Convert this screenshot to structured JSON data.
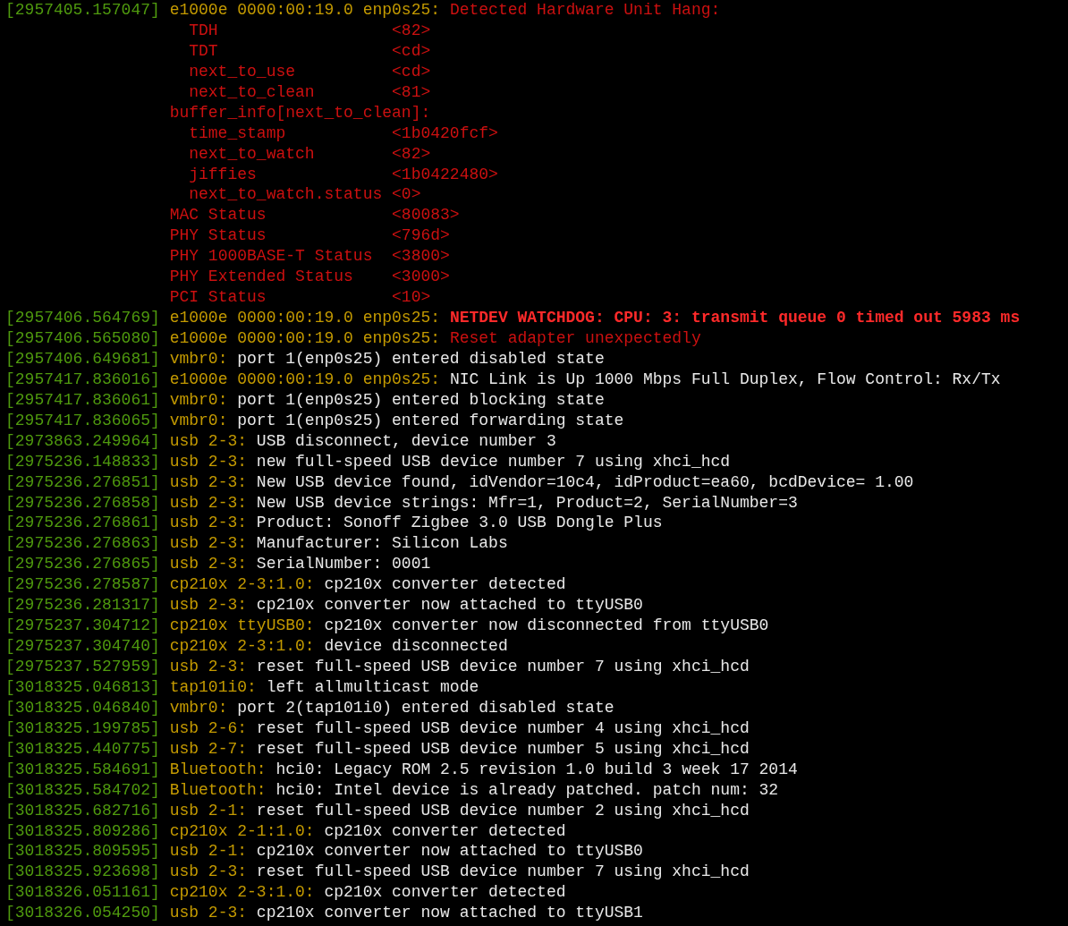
{
  "terminal": {
    "lines": [
      {
        "timestamp": "[2957405.157047]",
        "source": "e1000e 0000:00:19.0 enp0s25:",
        "message": "Detected Hardware Unit Hang:",
        "kind": "error",
        "details": [
          {
            "children": [
              {
                "label": "TDH",
                "value": "<82>"
              },
              {
                "label": "TDT",
                "value": "<cd>"
              },
              {
                "label": "next_to_use",
                "value": "<cd>"
              },
              {
                "label": "next_to_clean",
                "value": "<81>"
              }
            ]
          },
          {
            "label": "buffer_info[next_to_clean]:",
            "children": [
              {
                "label": "time_stamp",
                "value": "<1b0420fcf>"
              },
              {
                "label": "next_to_watch",
                "value": "<82>"
              },
              {
                "label": "jiffies",
                "value": "<1b0422480>"
              },
              {
                "label": "next_to_watch.status",
                "value": "<0>"
              }
            ]
          },
          {
            "label": "MAC Status",
            "value": "<80083>"
          },
          {
            "label": "PHY Status",
            "value": "<796d>"
          },
          {
            "label": "PHY 1000BASE-T Status",
            "value": "<3800>"
          },
          {
            "label": "PHY Extended Status",
            "value": "<3000>"
          },
          {
            "label": "PCI Status",
            "value": "<10>"
          }
        ]
      },
      {
        "timestamp": "[2957406.564769]",
        "source": "e1000e 0000:00:19.0 enp0s25:",
        "message": "NETDEV WATCHDOG: CPU: 3: transmit queue 0 timed out 5983 ms",
        "kind": "critical"
      },
      {
        "timestamp": "[2957406.565080]",
        "source": "e1000e 0000:00:19.0 enp0s25:",
        "message": "Reset adapter unexpectedly",
        "kind": "error"
      },
      {
        "timestamp": "[2957406.649681]",
        "source": "vmbr0:",
        "message": "port 1(enp0s25) entered disabled state",
        "kind": "normal"
      },
      {
        "timestamp": "[2957417.836016]",
        "source": "e1000e 0000:00:19.0 enp0s25:",
        "message": "NIC Link is Up 1000 Mbps Full Duplex, Flow Control: Rx/Tx",
        "kind": "normal"
      },
      {
        "timestamp": "[2957417.836061]",
        "source": "vmbr0:",
        "message": "port 1(enp0s25) entered blocking state",
        "kind": "normal"
      },
      {
        "timestamp": "[2957417.836065]",
        "source": "vmbr0:",
        "message": "port 1(enp0s25) entered forwarding state",
        "kind": "normal"
      },
      {
        "timestamp": "[2973863.249964]",
        "source": "usb 2-3:",
        "message": "USB disconnect, device number 3",
        "kind": "normal"
      },
      {
        "timestamp": "[2975236.148833]",
        "source": "usb 2-3:",
        "message": "new full-speed USB device number 7 using xhci_hcd",
        "kind": "normal"
      },
      {
        "timestamp": "[2975236.276851]",
        "source": "usb 2-3:",
        "message": "New USB device found, idVendor=10c4, idProduct=ea60, bcdDevice= 1.00",
        "kind": "normal"
      },
      {
        "timestamp": "[2975236.276858]",
        "source": "usb 2-3:",
        "message": "New USB device strings: Mfr=1, Product=2, SerialNumber=3",
        "kind": "normal"
      },
      {
        "timestamp": "[2975236.276861]",
        "source": "usb 2-3:",
        "message": "Product: Sonoff Zigbee 3.0 USB Dongle Plus",
        "kind": "normal"
      },
      {
        "timestamp": "[2975236.276863]",
        "source": "usb 2-3:",
        "message": "Manufacturer: Silicon Labs",
        "kind": "normal"
      },
      {
        "timestamp": "[2975236.276865]",
        "source": "usb 2-3:",
        "message": "SerialNumber: 0001",
        "kind": "normal"
      },
      {
        "timestamp": "[2975236.278587]",
        "source": "cp210x 2-3:1.0:",
        "message": "cp210x converter detected",
        "kind": "normal"
      },
      {
        "timestamp": "[2975236.281317]",
        "source": "usb 2-3:",
        "message": "cp210x converter now attached to ttyUSB0",
        "kind": "normal"
      },
      {
        "timestamp": "[2975237.304712]",
        "source": "cp210x ttyUSB0:",
        "message": "cp210x converter now disconnected from ttyUSB0",
        "kind": "normal"
      },
      {
        "timestamp": "[2975237.304740]",
        "source": "cp210x 2-3:1.0:",
        "message": "device disconnected",
        "kind": "normal"
      },
      {
        "timestamp": "[2975237.527959]",
        "source": "usb 2-3:",
        "message": "reset full-speed USB device number 7 using xhci_hcd",
        "kind": "normal"
      },
      {
        "timestamp": "[3018325.046813]",
        "source": "tap101i0:",
        "message": "left allmulticast mode",
        "kind": "normal"
      },
      {
        "timestamp": "[3018325.046840]",
        "source": "vmbr0:",
        "message": "port 2(tap101i0) entered disabled state",
        "kind": "normal"
      },
      {
        "timestamp": "[3018325.199785]",
        "source": "usb 2-6:",
        "message": "reset full-speed USB device number 4 using xhci_hcd",
        "kind": "normal"
      },
      {
        "timestamp": "[3018325.440775]",
        "source": "usb 2-7:",
        "message": "reset full-speed USB device number 5 using xhci_hcd",
        "kind": "normal"
      },
      {
        "timestamp": "[3018325.584691]",
        "source": "Bluetooth:",
        "message": "hci0: Legacy ROM 2.5 revision 1.0 build 3 week 17 2014",
        "kind": "normal"
      },
      {
        "timestamp": "[3018325.584702]",
        "source": "Bluetooth:",
        "message": "hci0: Intel device is already patched. patch num: 32",
        "kind": "normal"
      },
      {
        "timestamp": "[3018325.682716]",
        "source": "usb 2-1:",
        "message": "reset full-speed USB device number 2 using xhci_hcd",
        "kind": "normal"
      },
      {
        "timestamp": "[3018325.809286]",
        "source": "cp210x 2-1:1.0:",
        "message": "cp210x converter detected",
        "kind": "normal"
      },
      {
        "timestamp": "[3018325.809595]",
        "source": "usb 2-1:",
        "message": "cp210x converter now attached to ttyUSB0",
        "kind": "normal"
      },
      {
        "timestamp": "[3018325.923698]",
        "source": "usb 2-3:",
        "message": "reset full-speed USB device number 7 using xhci_hcd",
        "kind": "normal"
      },
      {
        "timestamp": "[3018326.051161]",
        "source": "cp210x 2-3:1.0:",
        "message": "cp210x converter detected",
        "kind": "normal"
      },
      {
        "timestamp": "[3018326.054250]",
        "source": "usb 2-3:",
        "message": "cp210x converter now attached to ttyUSB1",
        "kind": "normal"
      }
    ]
  }
}
